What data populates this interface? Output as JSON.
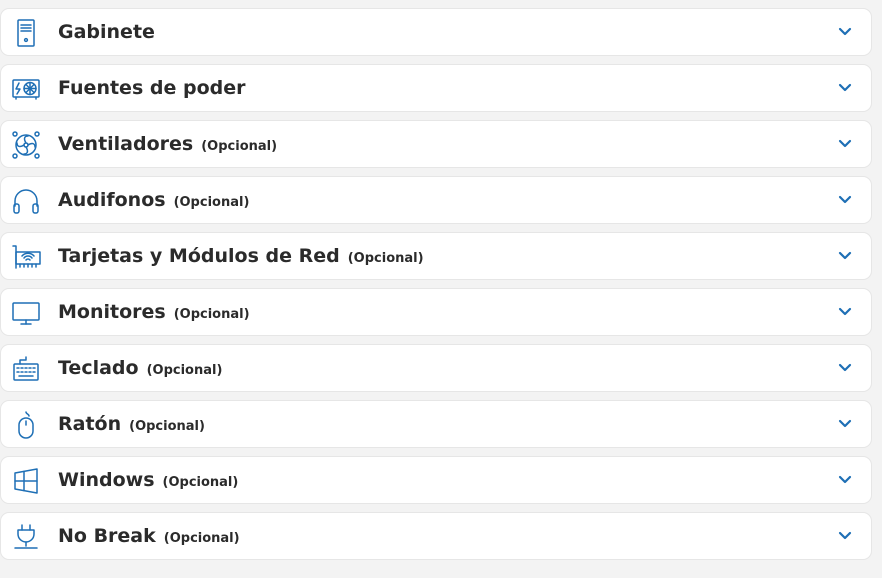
{
  "accent_color": "#1e6fb5",
  "text_color": "#2b2b2b",
  "optional_suffix": "(Opcional)",
  "items": [
    {
      "label": "Gabinete",
      "optional": "",
      "icon": "pc-case-icon"
    },
    {
      "label": "Fuentes de poder",
      "optional": "",
      "icon": "power-supply-icon"
    },
    {
      "label": "Ventiladores",
      "optional": "(Opcional)",
      "icon": "fan-icon"
    },
    {
      "label": "Audifonos",
      "optional": "(Opcional)",
      "icon": "headphones-icon"
    },
    {
      "label": "Tarjetas y Módulos de Red",
      "optional": "(Opcional)",
      "icon": "network-card-icon"
    },
    {
      "label": "Monitores",
      "optional": "(Opcional)",
      "icon": "monitor-icon"
    },
    {
      "label": "Teclado",
      "optional": "(Opcional)",
      "icon": "keyboard-icon"
    },
    {
      "label": "Ratón",
      "optional": "(Opcional)",
      "icon": "mouse-icon"
    },
    {
      "label": "Windows",
      "optional": "(Opcional)",
      "icon": "windows-icon"
    },
    {
      "label": "No Break",
      "optional": "(Opcional)",
      "icon": "ups-plug-icon"
    }
  ]
}
